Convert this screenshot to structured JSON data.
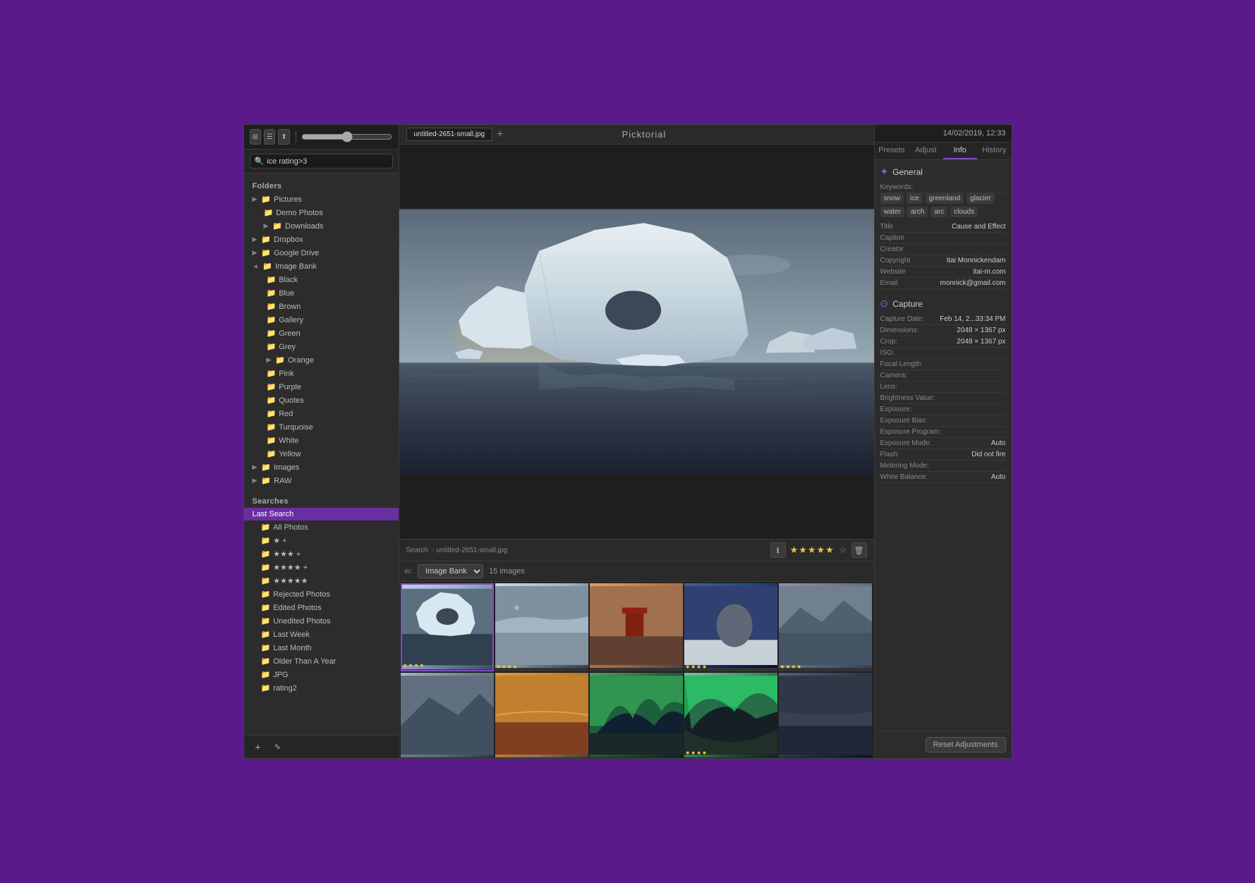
{
  "app": {
    "title": "Picktorial",
    "datetime": "14/02/2019, 12:33"
  },
  "toolbar": {
    "slider_value": "50",
    "search_placeholder": "ice rating>3",
    "search_value": "ice rating>3"
  },
  "sidebar": {
    "folders_label": "Folders",
    "searches_label": "Searches",
    "folders": [
      {
        "id": "pictures",
        "label": "Pictures",
        "level": 0,
        "has_children": true,
        "expanded": false
      },
      {
        "id": "demo-photos",
        "label": "Demo Photos",
        "level": 1,
        "has_children": false
      },
      {
        "id": "downloads",
        "label": "Downloads",
        "level": 1,
        "has_children": true,
        "expanded": false
      },
      {
        "id": "dropbox",
        "label": "Dropbox",
        "level": 0,
        "has_children": true,
        "expanded": false
      },
      {
        "id": "google-drive",
        "label": "Google Drive",
        "level": 0,
        "has_children": true,
        "expanded": false
      },
      {
        "id": "image-bank",
        "label": "Image Bank",
        "level": 0,
        "has_children": true,
        "expanded": true
      },
      {
        "id": "black",
        "label": "Black",
        "level": 1,
        "has_children": false
      },
      {
        "id": "blue",
        "label": "Blue",
        "level": 1,
        "has_children": false
      },
      {
        "id": "brown",
        "label": "Brown",
        "level": 1,
        "has_children": false
      },
      {
        "id": "gallery",
        "label": "Gallery",
        "level": 1,
        "has_children": false
      },
      {
        "id": "green",
        "label": "Green",
        "level": 1,
        "has_children": false
      },
      {
        "id": "grey",
        "label": "Grey",
        "level": 1,
        "has_children": false
      },
      {
        "id": "orange",
        "label": "Orange",
        "level": 1,
        "has_children": true,
        "expanded": false
      },
      {
        "id": "pink",
        "label": "Pink",
        "level": 1,
        "has_children": false
      },
      {
        "id": "purple",
        "label": "Purple",
        "level": 1,
        "has_children": false
      },
      {
        "id": "quotes",
        "label": "Quotes",
        "level": 1,
        "has_children": false
      },
      {
        "id": "red",
        "label": "Red",
        "level": 1,
        "has_children": false
      },
      {
        "id": "turquoise",
        "label": "Turquoise",
        "level": 1,
        "has_children": false
      },
      {
        "id": "white",
        "label": "White",
        "level": 1,
        "has_children": false
      },
      {
        "id": "yellow",
        "label": "Yellow",
        "level": 1,
        "has_children": false
      },
      {
        "id": "images",
        "label": "Images",
        "level": 0,
        "has_children": true,
        "expanded": false
      },
      {
        "id": "raw",
        "label": "RAW",
        "level": 0,
        "has_children": true,
        "expanded": false
      }
    ],
    "searches": [
      {
        "id": "last-search",
        "label": "Last Search",
        "selected": true
      },
      {
        "id": "all-photos",
        "label": "All Photos"
      },
      {
        "id": "2star",
        "label": "★ +"
      },
      {
        "id": "3star",
        "label": "★★★ +"
      },
      {
        "id": "4star",
        "label": "★★★★ +"
      },
      {
        "id": "5star",
        "label": "★★★★★"
      },
      {
        "id": "rejected",
        "label": "Rejected Photos"
      },
      {
        "id": "edited",
        "label": "Edited Photos"
      },
      {
        "id": "unedited",
        "label": "Unedited Photos"
      },
      {
        "id": "last-week",
        "label": "Last Week"
      },
      {
        "id": "last-month",
        "label": "Last Month"
      },
      {
        "id": "older-than-year",
        "label": "Older Than A Year"
      },
      {
        "id": "jpg",
        "label": "JPG"
      },
      {
        "id": "rating2",
        "label": "rating2"
      }
    ]
  },
  "main": {
    "tab_label": "untitled-2651-small.jpg",
    "image_count": "15 images",
    "folder_select": "Image Bank",
    "breadcrumb_search": "Search",
    "breadcrumb_file": "untitled-2651-small.jpg",
    "rating": "★★★★★",
    "rating_empty": "☆"
  },
  "right_panel": {
    "tabs": [
      "Presets",
      "Adjust",
      "Info",
      "History"
    ],
    "active_tab": "Info",
    "general_label": "General",
    "capture_label": "Capture",
    "general": {
      "keywords_label": "Keywords:",
      "keywords": [
        "snow",
        "ice",
        "greenland",
        "glacier",
        "water",
        "arch",
        "arc",
        "clouds"
      ],
      "title_label": "Title",
      "title_value": "Cause and  Effect",
      "caption_label": "Caption",
      "caption_value": "",
      "creator_label": "Creator",
      "creator_value": "",
      "copyright_label": "Copyright",
      "copyright_value": "Itai Monnickendam",
      "website_label": "Website",
      "website_value": "itai-m.com",
      "email_label": "Email",
      "email_value": "monnick@gmail.com"
    },
    "capture": {
      "date_label": "Capture Date:",
      "date_value": "Feb 14, 2...33:34 PM",
      "dimensions_label": "Dimensions:",
      "dimensions_value": "2048 × 1367 px",
      "crop_label": "Crop:",
      "crop_value": "2048 × 1367 px",
      "iso_label": "ISO:",
      "iso_value": "",
      "focal_label": "Focal Length:",
      "focal_value": "",
      "camera_label": "Camera:",
      "camera_value": "",
      "lens_label": "Lens:",
      "lens_value": "",
      "brightness_label": "Brightness Value:",
      "brightness_value": "",
      "exposure_label": "Exposure:",
      "exposure_value": "",
      "exposure_bias_label": "Exposure Bias:",
      "exposure_bias_value": "",
      "exposure_program_label": "Exposure Program:",
      "exposure_program_value": "",
      "exposure_mode_label": "Exposure Mode:",
      "exposure_mode_value": "Auto",
      "flash_label": "Flash:",
      "flash_value": "Did not fire",
      "metering_label": "Metering Mode:",
      "metering_value": "",
      "wb_label": "White Balance:",
      "wb_value": "Auto"
    },
    "reset_btn": "Reset Adjustments"
  },
  "thumbnails": [
    {
      "id": 1,
      "class": "thumb-selected",
      "selected": true,
      "rating": "● ● ● ●"
    },
    {
      "id": 2,
      "class": "thumb-2",
      "selected": false,
      "rating": "● ● ● ●"
    },
    {
      "id": 3,
      "class": "thumb-3",
      "selected": false,
      "rating": ""
    },
    {
      "id": 4,
      "class": "thumb-4",
      "selected": false,
      "rating": "● ● ● ●"
    },
    {
      "id": 5,
      "class": "thumb-5",
      "selected": false,
      "rating": "● ● ● ●"
    },
    {
      "id": 6,
      "class": "thumb-6",
      "selected": false,
      "rating": ""
    },
    {
      "id": 7,
      "class": "thumb-7",
      "selected": false,
      "rating": ""
    },
    {
      "id": 8,
      "class": "thumb-8",
      "selected": false,
      "rating": ""
    },
    {
      "id": 9,
      "class": "thumb-9",
      "selected": false,
      "rating": ""
    },
    {
      "id": 10,
      "class": "thumb-10",
      "selected": false,
      "rating": ""
    }
  ]
}
